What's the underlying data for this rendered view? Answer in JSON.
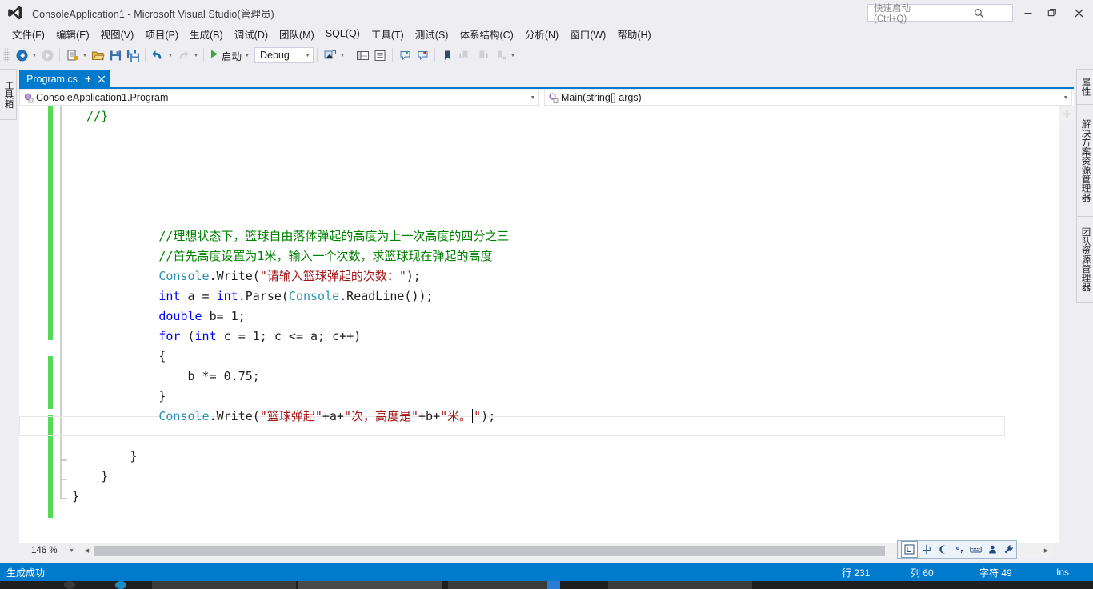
{
  "window": {
    "title": "ConsoleApplication1 - Microsoft Visual Studio(管理员)",
    "logo_icon": "visual-studio-logo-icon",
    "minimize_label": "—",
    "maximize_label": "❐",
    "close_label": "✕"
  },
  "quick_launch": {
    "placeholder": "快速启动 (Ctrl+Q)",
    "icon": "search-icon"
  },
  "menu": {
    "items": [
      {
        "label": "文件(F)"
      },
      {
        "label": "编辑(E)"
      },
      {
        "label": "视图(V)"
      },
      {
        "label": "项目(P)"
      },
      {
        "label": "生成(B)"
      },
      {
        "label": "调试(D)"
      },
      {
        "label": "团队(M)"
      },
      {
        "label": "SQL(Q)"
      },
      {
        "label": "工具(T)"
      },
      {
        "label": "测试(S)"
      },
      {
        "label": "体系结构(C)"
      },
      {
        "label": "分析(N)"
      },
      {
        "label": "窗口(W)"
      },
      {
        "label": "帮助(H)"
      }
    ]
  },
  "toolbar": {
    "navigate_back_icon": "navigate-back-icon",
    "navigate_forward_icon": "navigate-forward-icon",
    "new_project_icon": "new-project-icon",
    "open_file_icon": "open-file-icon",
    "save_icon": "save-icon",
    "save_all_icon": "save-all-icon",
    "undo_icon": "undo-icon",
    "redo_icon": "redo-icon",
    "start_icon": "start-debug-play-icon",
    "start_label": "启动",
    "config_value": "Debug",
    "find_icon": "find-in-files-icon",
    "solution_icon": "solution-explorer-icon",
    "properties_window_icon": "properties-window-icon",
    "comment_icon": "comment-selection-icon",
    "uncomment_icon": "uncomment-selection-icon",
    "bookmark_icon": "bookmark-icon",
    "prev_bookmark_icon": "previous-bookmark-icon",
    "next_bookmark_icon": "next-bookmark-icon",
    "clear_bookmarks_icon": "clear-bookmarks-icon",
    "overflow_icon": "toolbar-overflow-icon"
  },
  "left_dock": {
    "items": [
      {
        "label": "工具箱",
        "icon": "toolbox-icon"
      }
    ]
  },
  "right_dock": {
    "items": [
      {
        "label": "属性"
      },
      {
        "label": "解决方案资源管理器"
      },
      {
        "label": "团队资源管理器"
      }
    ]
  },
  "document": {
    "tab": {
      "label": "Program.cs",
      "pin_icon": "pin-icon",
      "close_icon": "close-icon"
    }
  },
  "navbar": {
    "class_icon": "class-member-icon",
    "class_value": "ConsoleApplication1.Program",
    "member_icon": "method-icon",
    "member_value": "Main(string[] args)",
    "dropdown_icon": "chevron-down-icon"
  },
  "editor": {
    "lines": [
      {
        "indent": 0,
        "segments": [
          {
            "t": "  //}",
            "c": "cmt"
          }
        ]
      },
      {
        "indent": 0,
        "segments": []
      },
      {
        "indent": 0,
        "segments": []
      },
      {
        "indent": 0,
        "segments": []
      },
      {
        "indent": 0,
        "segments": []
      },
      {
        "indent": 0,
        "segments": []
      },
      {
        "indent": 0,
        "segments": [
          {
            "t": "            //理想状态下，篮球自由落体弹起的高度为上一次高度的四分之三",
            "c": "cmt"
          }
        ]
      },
      {
        "indent": 0,
        "segments": [
          {
            "t": "            //首先高度设置为1米，输入一个次数，求篮球现在弹起的高度",
            "c": "cmt"
          }
        ]
      },
      {
        "indent": 0,
        "segments": [
          {
            "t": "            ",
            "c": ""
          },
          {
            "t": "Console",
            "c": "type"
          },
          {
            "t": ".Write(",
            "c": ""
          },
          {
            "t": "\"请输入篮球弹起的次数：\"",
            "c": "str"
          },
          {
            "t": ");",
            "c": ""
          }
        ]
      },
      {
        "indent": 0,
        "segments": [
          {
            "t": "            ",
            "c": ""
          },
          {
            "t": "int",
            "c": "kw"
          },
          {
            "t": " a = ",
            "c": ""
          },
          {
            "t": "int",
            "c": "kw"
          },
          {
            "t": ".Parse(",
            "c": ""
          },
          {
            "t": "Console",
            "c": "type"
          },
          {
            "t": ".ReadLine());",
            "c": ""
          }
        ]
      },
      {
        "indent": 0,
        "segments": [
          {
            "t": "            ",
            "c": ""
          },
          {
            "t": "double",
            "c": "kw"
          },
          {
            "t": " b= 1;",
            "c": ""
          }
        ]
      },
      {
        "indent": 0,
        "segments": [
          {
            "t": "            ",
            "c": ""
          },
          {
            "t": "for",
            "c": "kw"
          },
          {
            "t": " (",
            "c": ""
          },
          {
            "t": "int",
            "c": "kw"
          },
          {
            "t": " c = 1; c <= a; c++)",
            "c": ""
          }
        ]
      },
      {
        "indent": 0,
        "segments": [
          {
            "t": "            {",
            "c": ""
          }
        ]
      },
      {
        "indent": 0,
        "segments": [
          {
            "t": "                b *= 0.75;",
            "c": ""
          }
        ]
      },
      {
        "indent": 0,
        "segments": [
          {
            "t": "            }",
            "c": ""
          }
        ]
      },
      {
        "indent": 0,
        "segments": [
          {
            "t": "            ",
            "c": ""
          },
          {
            "t": "Console",
            "c": "type"
          },
          {
            "t": ".Write(",
            "c": ""
          },
          {
            "t": "\"篮球弹起\"",
            "c": "str"
          },
          {
            "t": "+a+",
            "c": ""
          },
          {
            "t": "\"次，高度是\"",
            "c": "str"
          },
          {
            "t": "+b+",
            "c": ""
          },
          {
            "t": "\"米。",
            "c": "str"
          },
          {
            "t": "CARET",
            "c": "caret"
          },
          {
            "t": "\"",
            "c": "str"
          },
          {
            "t": ");",
            "c": ""
          }
        ]
      },
      {
        "indent": 0,
        "segments": []
      },
      {
        "indent": 0,
        "segments": [
          {
            "t": "        }",
            "c": ""
          }
        ]
      },
      {
        "indent": 0,
        "segments": [
          {
            "t": "    }",
            "c": ""
          }
        ]
      },
      {
        "indent": 0,
        "segments": [
          {
            "t": "}",
            "c": ""
          }
        ]
      }
    ],
    "current_line_index": 15
  },
  "scrollbars": {
    "up_arrow": "▲",
    "down_arrow": "▼",
    "left_arrow": "◀",
    "right_arrow": "▶",
    "splitter_icon": "split-editor-icon"
  },
  "zoom": {
    "value": "146 %",
    "dropdown_icon": "chevron-down-icon"
  },
  "ime": {
    "logo_icon": "ime-logo-icon",
    "mode_label": "中",
    "moon_icon": "half-width-moon-icon",
    "punct_icon": "punctuation-icon",
    "keyboard_icon": "soft-keyboard-icon",
    "user_icon": "user-dictionary-icon",
    "tools_icon": "ime-settings-wrench-icon"
  },
  "status": {
    "message": "生成成功",
    "line_label": "行 231",
    "col_label": "列 60",
    "char_label": "字符 49",
    "insert_mode": "Ins"
  },
  "colors": {
    "accent": "#007acc",
    "chrome": "#eeeef2",
    "keyword": "#0000ff",
    "type": "#2b91af",
    "string": "#a31515",
    "comment": "#008000",
    "changebar": "#57d957"
  }
}
